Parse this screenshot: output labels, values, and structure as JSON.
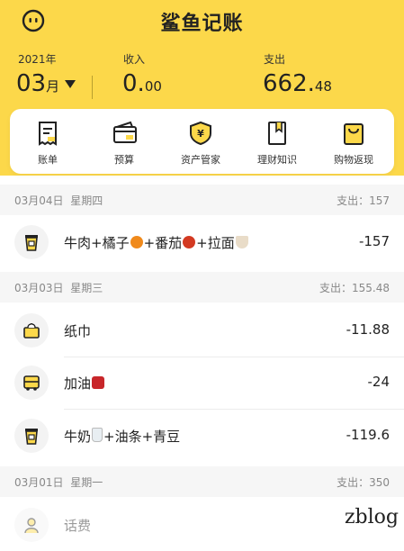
{
  "app_title": "鲨鱼记账",
  "header": {
    "year": "2021年",
    "month": "03",
    "month_unit": "月",
    "income_label": "收入",
    "income_int": "0.",
    "income_dec": "00",
    "expense_label": "支出",
    "expense_int": "662.",
    "expense_dec": "48"
  },
  "menu": [
    {
      "label": "账单",
      "icon": "bill-icon"
    },
    {
      "label": "预算",
      "icon": "budget-icon"
    },
    {
      "label": "资产管家",
      "icon": "asset-icon"
    },
    {
      "label": "理财知识",
      "icon": "finance-book-icon"
    },
    {
      "label": "购物返现",
      "icon": "shopping-bag-icon"
    }
  ],
  "groups": [
    {
      "date": "03月04日",
      "weekday": "星期四",
      "total": "支出：157",
      "items": [
        {
          "name": "牛肉+橘子",
          "name_part2": "+番茄",
          "name_part3": "+拉面",
          "amount": "-157",
          "icon": "cup-icon"
        }
      ]
    },
    {
      "date": "03月03日",
      "weekday": "星期三",
      "total": "支出：155.48",
      "items": [
        {
          "name": "纸巾",
          "amount": "-11.88",
          "icon": "tissue-box-icon"
        },
        {
          "name": "加油",
          "amount": "-24",
          "icon": "car-icon"
        },
        {
          "name": "牛奶",
          "name_part2": "+油条+青豆",
          "amount": "-119.6",
          "icon": "cup-icon"
        }
      ]
    },
    {
      "date": "03月01日",
      "weekday": "星期一",
      "total": "支出：350",
      "items": [
        {
          "name": "话费",
          "icon": "phone-bill-icon"
        }
      ]
    }
  ],
  "watermark": "zblog",
  "colors": {
    "brand_yellow": "#fcd84a",
    "icon_bg": "#f3f3f3"
  }
}
